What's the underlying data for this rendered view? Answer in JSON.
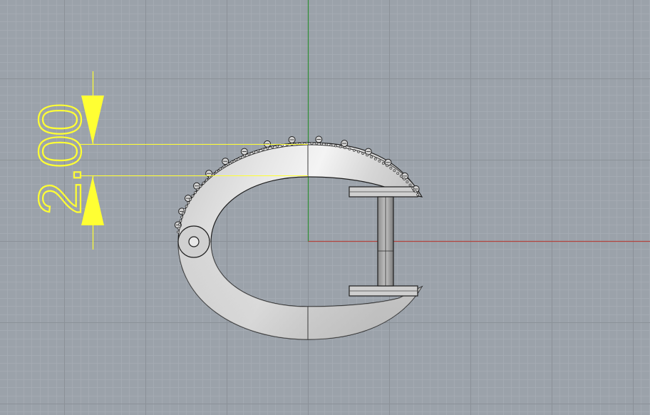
{
  "viewport": {
    "background_color": "#9ba2aa",
    "grid_minor_color": "#a7adb4",
    "grid_major_color": "#8b9198",
    "x_axis_color": "#b2443f",
    "y_axis_color": "#2f8e35"
  },
  "dimension": {
    "value_text": "2.00",
    "color": "#ffff33"
  },
  "model": {
    "fill_color": "#d9d9d9",
    "edge_color": "#1e1e1e"
  }
}
